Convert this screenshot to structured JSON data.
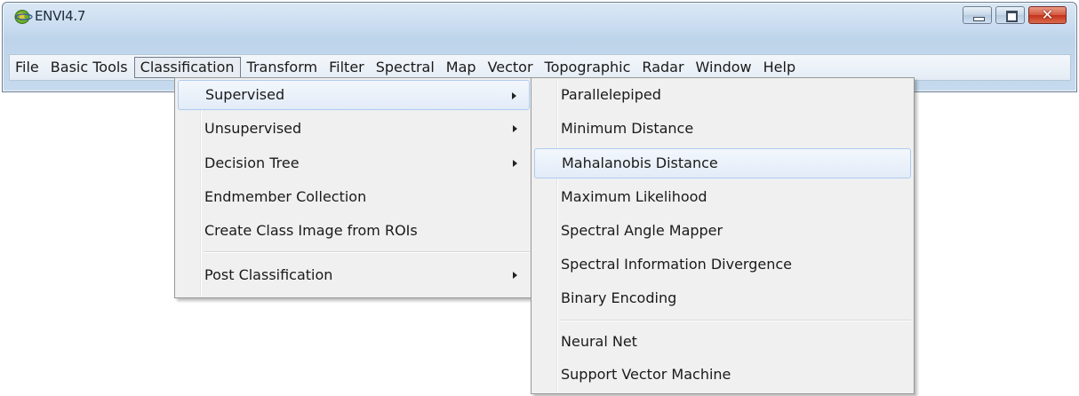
{
  "window": {
    "title": "ENVI4.7",
    "minimize_icon": "minimize-icon",
    "maximize_icon": "maximize-icon",
    "close_icon": "close-icon"
  },
  "menubar": {
    "items": [
      "File",
      "Basic Tools",
      "Classification",
      "Transform",
      "Filter",
      "Spectral",
      "Map",
      "Vector",
      "Topographic",
      "Radar",
      "Window",
      "Help"
    ],
    "active": "Classification"
  },
  "classification_menu": {
    "items": [
      {
        "label": "Supervised",
        "submenu": true,
        "highlighted": true
      },
      {
        "label": "Unsupervised",
        "submenu": true
      },
      {
        "label": "Decision Tree",
        "submenu": true
      },
      {
        "label": "Endmember Collection"
      },
      {
        "label": "Create Class Image from ROIs"
      },
      {
        "label": "Post Classification",
        "submenu": true
      }
    ]
  },
  "supervised_menu": {
    "items": [
      {
        "label": "Parallelepiped"
      },
      {
        "label": "Minimum Distance"
      },
      {
        "label": "Mahalanobis Distance",
        "highlighted": true
      },
      {
        "label": "Maximum Likelihood"
      },
      {
        "label": "Spectral Angle Mapper"
      },
      {
        "label": "Spectral Information Divergence"
      },
      {
        "label": "Binary Encoding"
      },
      {
        "label": "Neural Net"
      },
      {
        "label": "Support Vector Machine"
      }
    ]
  },
  "colors": {
    "highlight_border": "#aecbef",
    "close_button": "#c6321a"
  }
}
